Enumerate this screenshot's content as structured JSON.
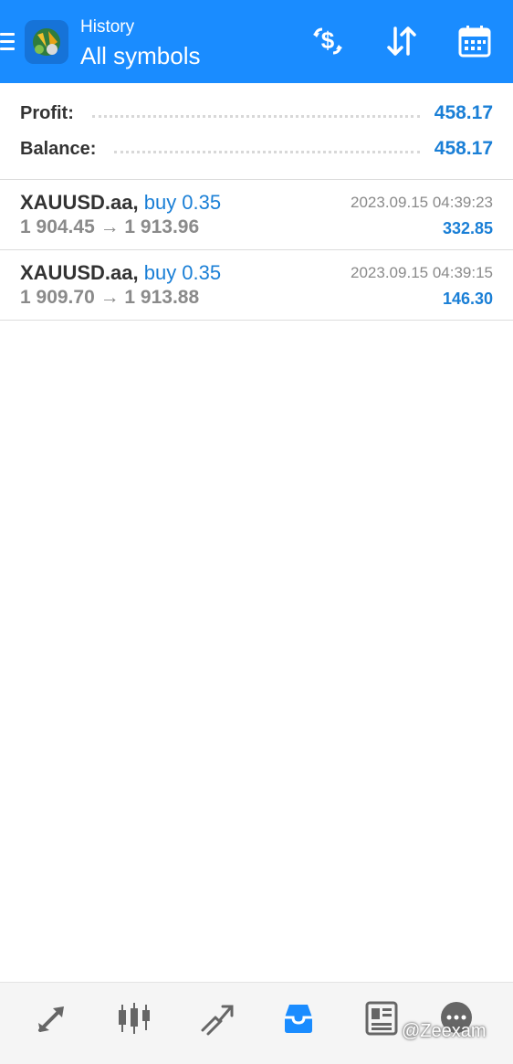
{
  "header": {
    "subtitle": "History",
    "title": "All symbols",
    "icons": [
      "menu-icon",
      "metatrader-logo",
      "currency-exchange-icon",
      "sort-icon",
      "calendar-icon"
    ],
    "background_color": "#1a8cff"
  },
  "summary": {
    "profit_label": "Profit:",
    "profit_value": "458.17",
    "balance_label": "Balance:",
    "balance_value": "458.17",
    "value_color": "#1a7fd6"
  },
  "deals": [
    {
      "symbol": "XAUUSD.aa,",
      "side": "buy 0.35",
      "prices": "1 904.45 → 1 913.96",
      "time": "2023.09.15 04:39:23",
      "profit": "332.85"
    },
    {
      "symbol": "XAUUSD.aa,",
      "side": "buy 0.35",
      "prices": "1 909.70 → 1 913.88",
      "time": "2023.09.15 04:39:15",
      "profit": "146.30"
    }
  ],
  "bottom_nav": {
    "items": [
      "quotes-icon",
      "chart-icon",
      "trade-icon",
      "history-icon",
      "news-icon",
      "messages-icon"
    ],
    "active": "history-icon",
    "active_color": "#1a8cff",
    "inactive_color": "#666666"
  },
  "watermark": "@Zeexam"
}
